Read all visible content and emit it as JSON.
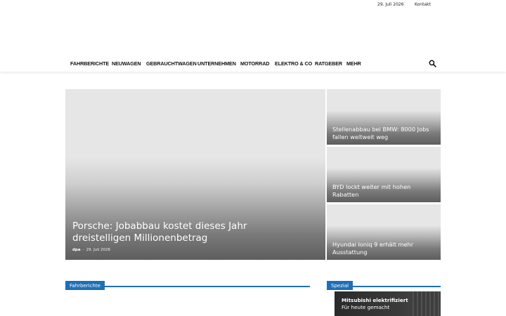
{
  "topbar": {
    "date": "29. Juli 2026",
    "contact": "Kontakt"
  },
  "nav": {
    "items": [
      "FAHRBERICHTE",
      "NEUWAGEN",
      "GEBRAUCHTWAGEN",
      "UNTERNEHMEN",
      "MOTORRAD",
      "ELEKTRO & CO",
      "RATGEBER",
      "MEHR"
    ],
    "search_icon": "search-icon"
  },
  "hero": {
    "title": "Porsche: Jobabbau kostet dieses Jahr dreistelligen Millionenbetrag",
    "author": "dpa",
    "separator": "-",
    "date": "29. Juli 2026"
  },
  "side_articles": [
    {
      "title": "Stellenabbau bei BMW: 8000 Jobs fallen weltweit weg"
    },
    {
      "title": "BYD lockt weiter mit hohen Rabatten"
    },
    {
      "title": "Hyundai Ioniq 9 erhält mehr Ausstattung"
    }
  ],
  "sections": {
    "left": "Fahrberichte",
    "right": "Spezial"
  },
  "promo": {
    "line1": "Mitsubishi elektrifiziert",
    "line2": "Für heute gemacht"
  },
  "colors": {
    "accent": "#1e6fb8",
    "nav_text": "#111111",
    "overlay_text": "#ffffff"
  }
}
